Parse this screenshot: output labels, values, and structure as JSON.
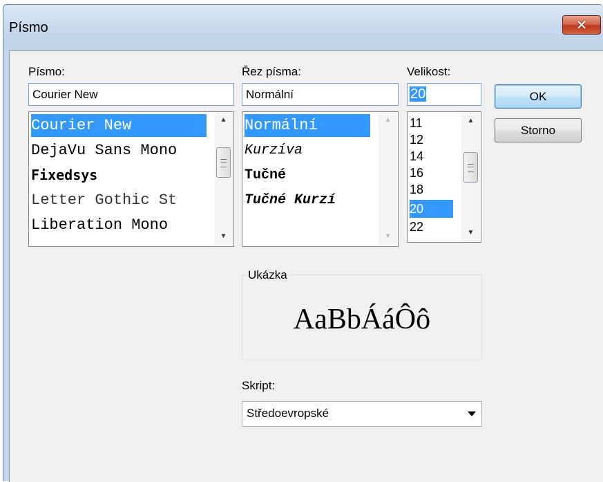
{
  "window": {
    "title": "Písmo",
    "close_label": "✕"
  },
  "font": {
    "label": "Písmo:",
    "value": "Courier New",
    "items": [
      "Courier New",
      "DejaVu Sans Mono",
      "Fixedsys",
      "Letter Gothic St",
      "Liberation Mono"
    ],
    "selected": "Courier New"
  },
  "style": {
    "label": "Řez písma:",
    "value": "Normální",
    "items": [
      "Normální",
      "Kurzíva",
      "Tučné",
      "Tučné Kurzí"
    ],
    "selected": "Normální"
  },
  "size": {
    "label": "Velikost:",
    "value": "20",
    "items": [
      "11",
      "12",
      "14",
      "16",
      "18",
      "20",
      "22"
    ],
    "selected": "20"
  },
  "buttons": {
    "ok": "OK",
    "cancel": "Storno"
  },
  "sample": {
    "label": "Ukázka",
    "text": "AaBbÁáÔô"
  },
  "script": {
    "label": "Skript:",
    "value": "Středoevropské"
  },
  "colors": {
    "selection": "#3399ff",
    "close_button": "#c0381d",
    "titlebar": "#c8d9ee"
  }
}
